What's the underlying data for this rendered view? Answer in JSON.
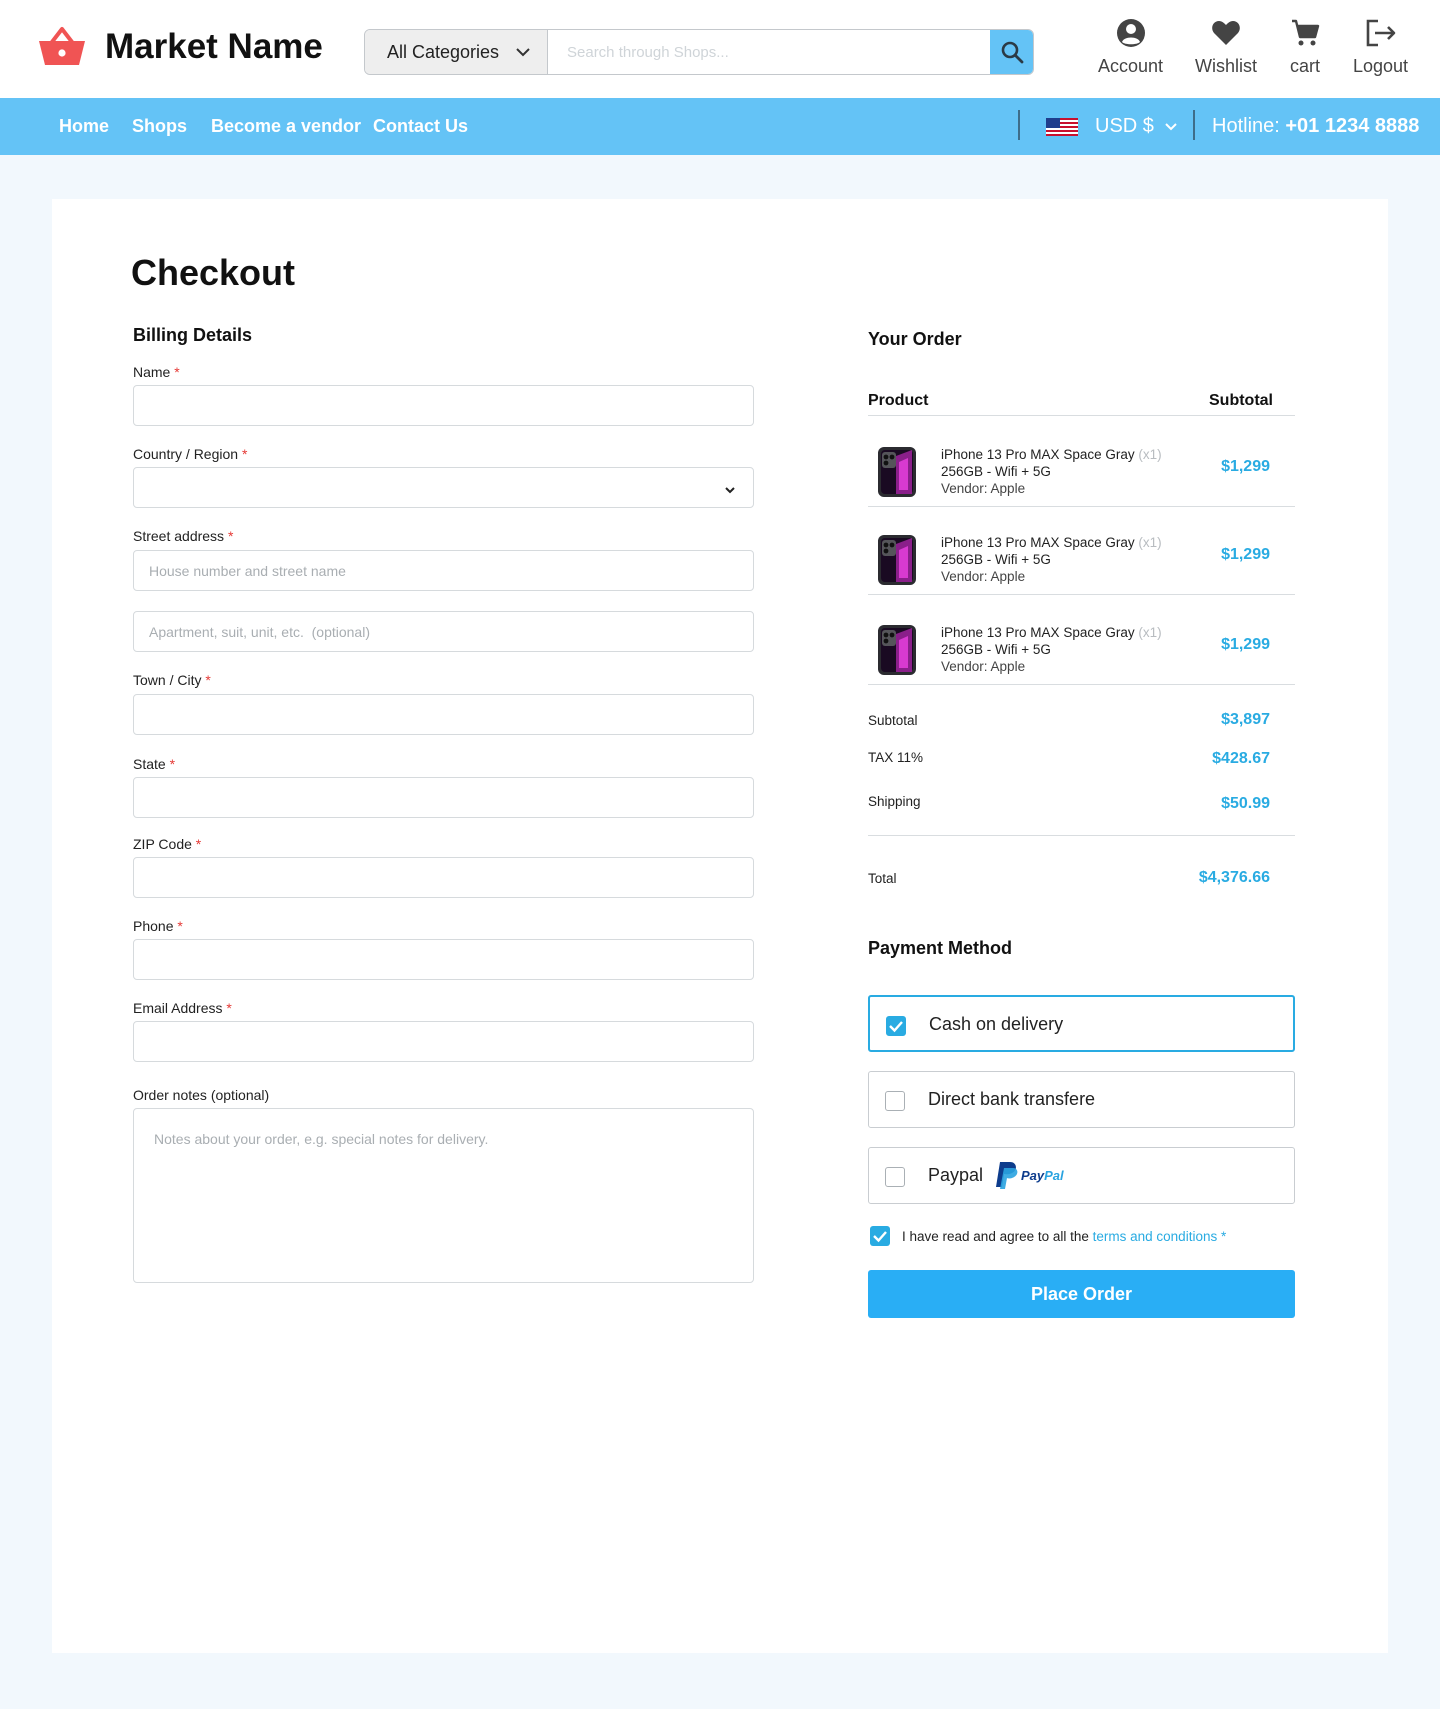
{
  "header": {
    "brand": "Market Name",
    "category_select": "All Categories",
    "search_placeholder": "Search through Shops...",
    "actions": [
      {
        "label": "Account",
        "icon": "account-icon"
      },
      {
        "label": "Wishlist",
        "icon": "heart-icon"
      },
      {
        "label": "cart",
        "icon": "cart-icon"
      },
      {
        "label": "Logout",
        "icon": "logout-icon"
      }
    ]
  },
  "nav": {
    "links": [
      "Home",
      "Shops",
      "Become a vendor",
      "Contact Us"
    ],
    "currency": "USD $",
    "hotline_label": "Hotline:",
    "hotline_number": "+01 1234 8888"
  },
  "checkout": {
    "title": "Checkout",
    "billing_title": "Billing Details",
    "required_mark": "*",
    "fields": {
      "name": {
        "label": "Name"
      },
      "country": {
        "label": "Country / Region"
      },
      "street": {
        "label": "Street address",
        "placeholder": "House number and street name"
      },
      "street2": {
        "placeholder": "Apartment, suit, unit, etc.  (optional)"
      },
      "city": {
        "label": "Town / City"
      },
      "state": {
        "label": "State"
      },
      "zip": {
        "label": "ZIP Code"
      },
      "phone": {
        "label": "Phone"
      },
      "email": {
        "label": "Email Address"
      },
      "notes": {
        "label": "Order notes (optional)",
        "placeholder": "Notes about your order, e.g. special notes for delivery."
      }
    }
  },
  "order": {
    "title": "Your Order",
    "col_product": "Product",
    "col_subtotal": "Subtotal",
    "items": [
      {
        "name": "iPhone 13 Pro MAX Space Gray",
        "qty": "(x1)",
        "spec": "256GB - Wifi + 5G",
        "vendor": "Vendor: Apple",
        "price": "$1,299"
      },
      {
        "name": "iPhone 13 Pro MAX Space Gray",
        "qty": "(x1)",
        "spec": "256GB - Wifi + 5G",
        "vendor": "Vendor: Apple",
        "price": "$1,299"
      },
      {
        "name": "iPhone 13 Pro MAX Space Gray",
        "qty": "(x1)",
        "spec": "256GB - Wifi + 5G",
        "vendor": "Vendor: Apple",
        "price": "$1,299"
      }
    ],
    "subtotal_label": "Subtotal",
    "subtotal_value": "$3,897",
    "tax_label": "TAX 11%",
    "tax_value": "$428.67",
    "shipping_label": "Shipping",
    "shipping_value": "$50.99",
    "total_label": "Total",
    "total_value": "$4,376.66"
  },
  "payment": {
    "title": "Payment Method",
    "options": [
      {
        "label": "Cash on delivery",
        "selected": true
      },
      {
        "label": "Direct bank transfere",
        "selected": false
      },
      {
        "label": "Paypal",
        "selected": false,
        "logo_text_1": "Pay",
        "logo_text_2": "Pal"
      }
    ],
    "agree_text": "I have read and agree to all the ",
    "agree_link": "terms and conditions",
    "agree_req": " *",
    "place_order": "Place Order"
  },
  "colors": {
    "accent": "#29abe2",
    "nav_bg": "#64c3f6",
    "logo_red": "#f05454",
    "required": "#e53935"
  }
}
